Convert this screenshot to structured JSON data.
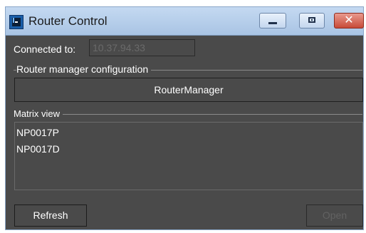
{
  "window": {
    "title": "Router Control",
    "icons": {
      "app": "app-icon",
      "minimize": "minimize-icon",
      "maximize": "maximize-icon",
      "close": "close-icon"
    },
    "close_glyph": "✕"
  },
  "connection": {
    "label": "Connected to:",
    "value": "10.37.94.33"
  },
  "router_manager": {
    "group_title": "Router manager configuration",
    "button_label": "RouterManager"
  },
  "matrix_view": {
    "group_title": "Matrix view",
    "items": [
      "NP0017P",
      "NP0017D"
    ]
  },
  "actions": {
    "refresh_label": "Refresh",
    "open_label": "Open",
    "open_enabled": false
  },
  "colors": {
    "background": "#4a4a4a",
    "titlebar": "#b8d0ec",
    "close_button": "#c84a38"
  }
}
